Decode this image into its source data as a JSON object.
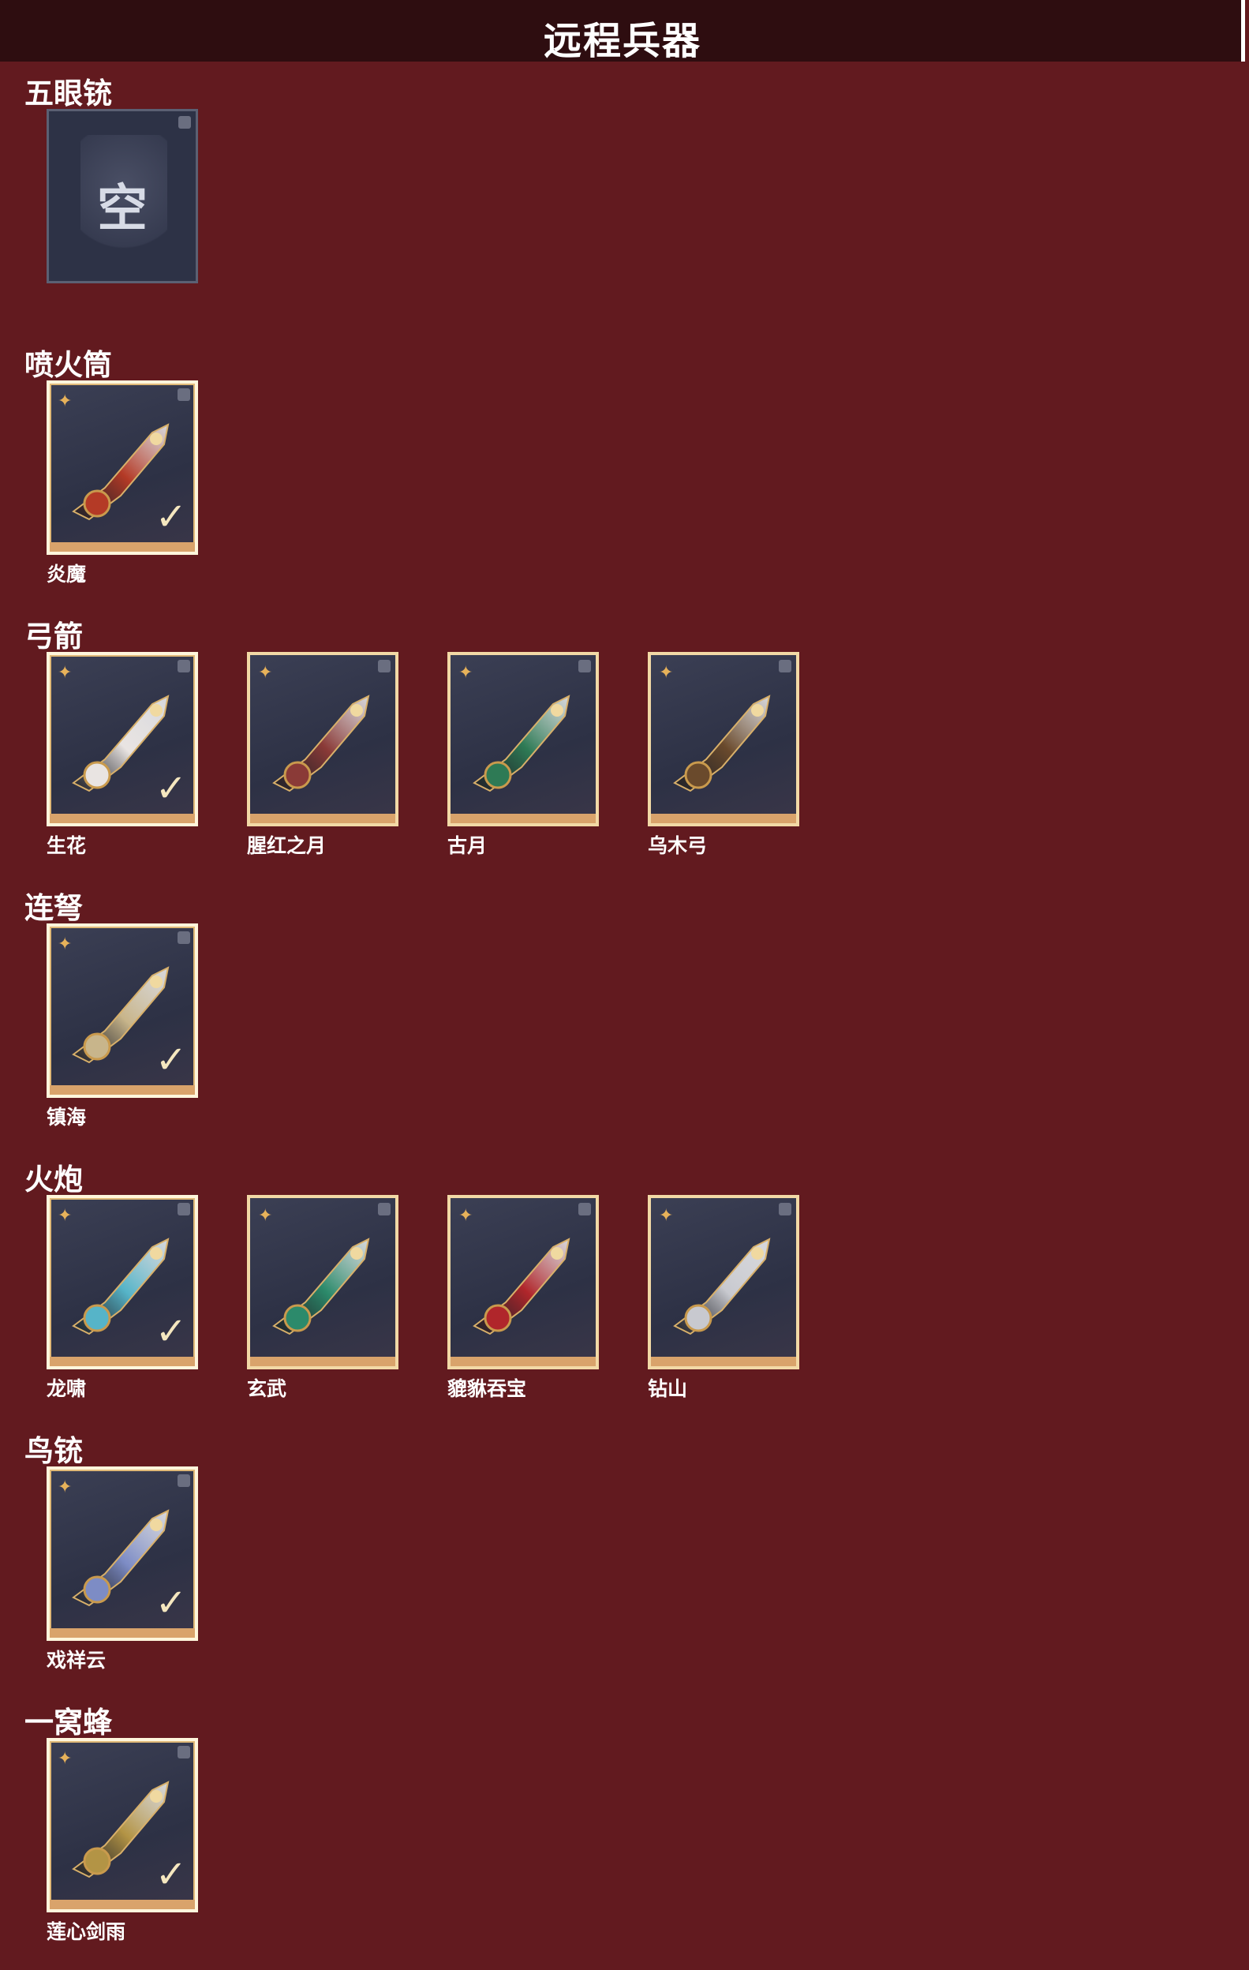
{
  "header": {
    "title": "远程兵器"
  },
  "colors": {
    "background": "#621a1f",
    "header": "#2e0d10",
    "card_bg": "#2d3145",
    "owned_border": "#fff6dc",
    "gold_border": "#f2d9a6",
    "rarity_icon": "#e7b25a"
  },
  "sections": [
    {
      "title": "五眼铳",
      "items": [
        {
          "label": "",
          "empty_text": "空",
          "state": "empty"
        }
      ]
    },
    {
      "title": "喷火筒",
      "items": [
        {
          "label": "炎魔",
          "state": "owned",
          "art_color": "#b43a26"
        }
      ]
    },
    {
      "title": "弓箭",
      "items": [
        {
          "label": "生花",
          "state": "owned",
          "art_color": "#e9e4e2"
        },
        {
          "label": "腥红之月",
          "state": "available",
          "art_color": "#8a3a37"
        },
        {
          "label": "古月",
          "state": "available",
          "art_color": "#2e7a55"
        },
        {
          "label": "乌木弓",
          "state": "available",
          "art_color": "#6a4a2c"
        }
      ]
    },
    {
      "title": "连弩",
      "items": [
        {
          "label": "镇海",
          "state": "owned",
          "art_color": "#c8b58b"
        }
      ]
    },
    {
      "title": "火炮",
      "items": [
        {
          "label": "龙啸",
          "state": "owned",
          "art_color": "#56b4c8"
        },
        {
          "label": "玄武",
          "state": "available",
          "art_color": "#2c8a6b"
        },
        {
          "label": "貔貅吞宝",
          "state": "available",
          "art_color": "#b0262b"
        },
        {
          "label": "钻山",
          "state": "available",
          "art_color": "#c8c9cf"
        }
      ]
    },
    {
      "title": "鸟铳",
      "items": [
        {
          "label": "戏祥云",
          "state": "owned",
          "art_color": "#7d8cc5"
        }
      ]
    },
    {
      "title": "一窝蜂",
      "items": [
        {
          "label": "莲心剑雨",
          "state": "owned",
          "art_color": "#b39445"
        }
      ]
    }
  ]
}
